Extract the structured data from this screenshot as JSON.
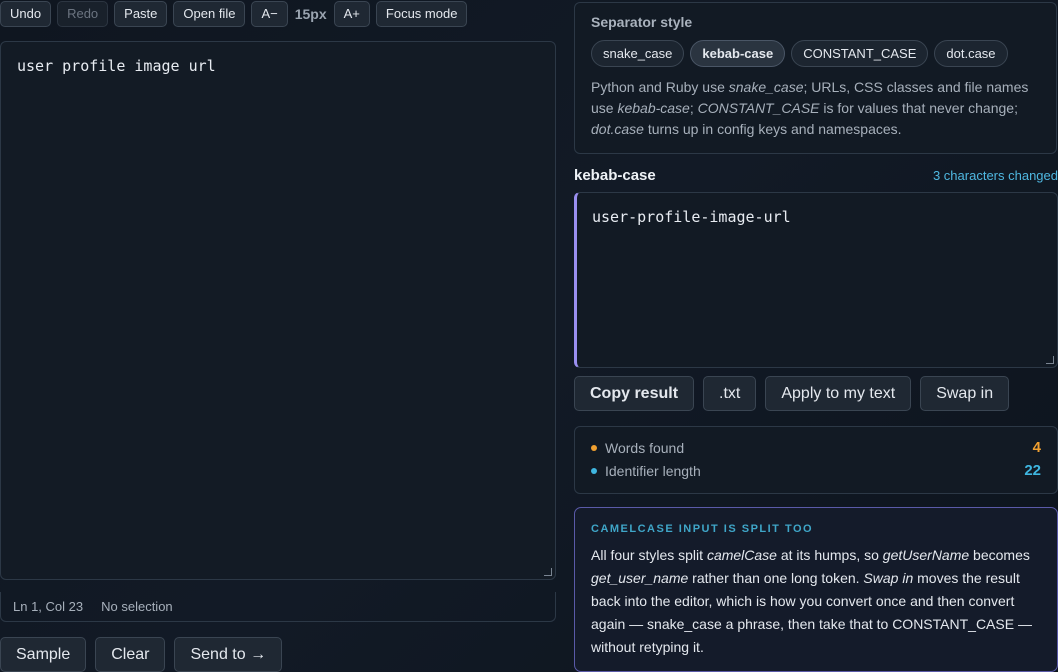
{
  "toolbar": {
    "undo": "Undo",
    "redo": "Redo",
    "paste": "Paste",
    "open_file": "Open file",
    "font_decrease": "A−",
    "font_size": "15px",
    "font_increase": "A+",
    "focus_mode": "Focus mode"
  },
  "editor": {
    "value": "user profile image url"
  },
  "status": {
    "position": "Ln 1, Col 23",
    "selection": "No selection"
  },
  "bottom_buttons": {
    "sample": "Sample",
    "clear": "Clear",
    "send_to": "Send to →"
  },
  "separator": {
    "title": "Separator style",
    "options": [
      "snake_case",
      "kebab-case",
      "CONSTANT_CASE",
      "dot.case"
    ],
    "selected": "kebab-case",
    "desc": {
      "p1": "Python and Ruby use ",
      "snake": "snake_case",
      "p2": "; URLs, CSS classes and file names use ",
      "kebab": "kebab-case",
      "p3": "; ",
      "constant": "CONSTANT_CASE",
      "p4": " is for values that never change; ",
      "dot": "dot.case",
      "p5": " turns up in config keys and namespaces."
    }
  },
  "result": {
    "title": "kebab-case",
    "changes": "3 characters changed",
    "value": "user-profile-image-url",
    "accent_color": "#9a8ff0"
  },
  "result_actions": {
    "copy": "Copy result",
    "txt": ".txt",
    "apply": "Apply to my text",
    "swap": "Swap in"
  },
  "stats": [
    {
      "label": "Words found",
      "value": "4",
      "color": "#f0a030"
    },
    {
      "label": "Identifier length",
      "value": "22",
      "color": "#3fb6e0"
    }
  ],
  "tip": {
    "title": "CAMELCASE INPUT IS SPLIT TOO",
    "t1": "All four styles split ",
    "camel": "camelCase",
    "t2": " at its humps, so ",
    "getuser": "getUserName",
    "t3": " becomes ",
    "get_user": "get_user_name",
    "t4": " rather than one long token. ",
    "swap": "Swap in",
    "t5": " moves the result back into the editor, which is how you convert once and then convert again — snake_case a phrase, then take that to CONSTANT_CASE — without retyping it."
  }
}
